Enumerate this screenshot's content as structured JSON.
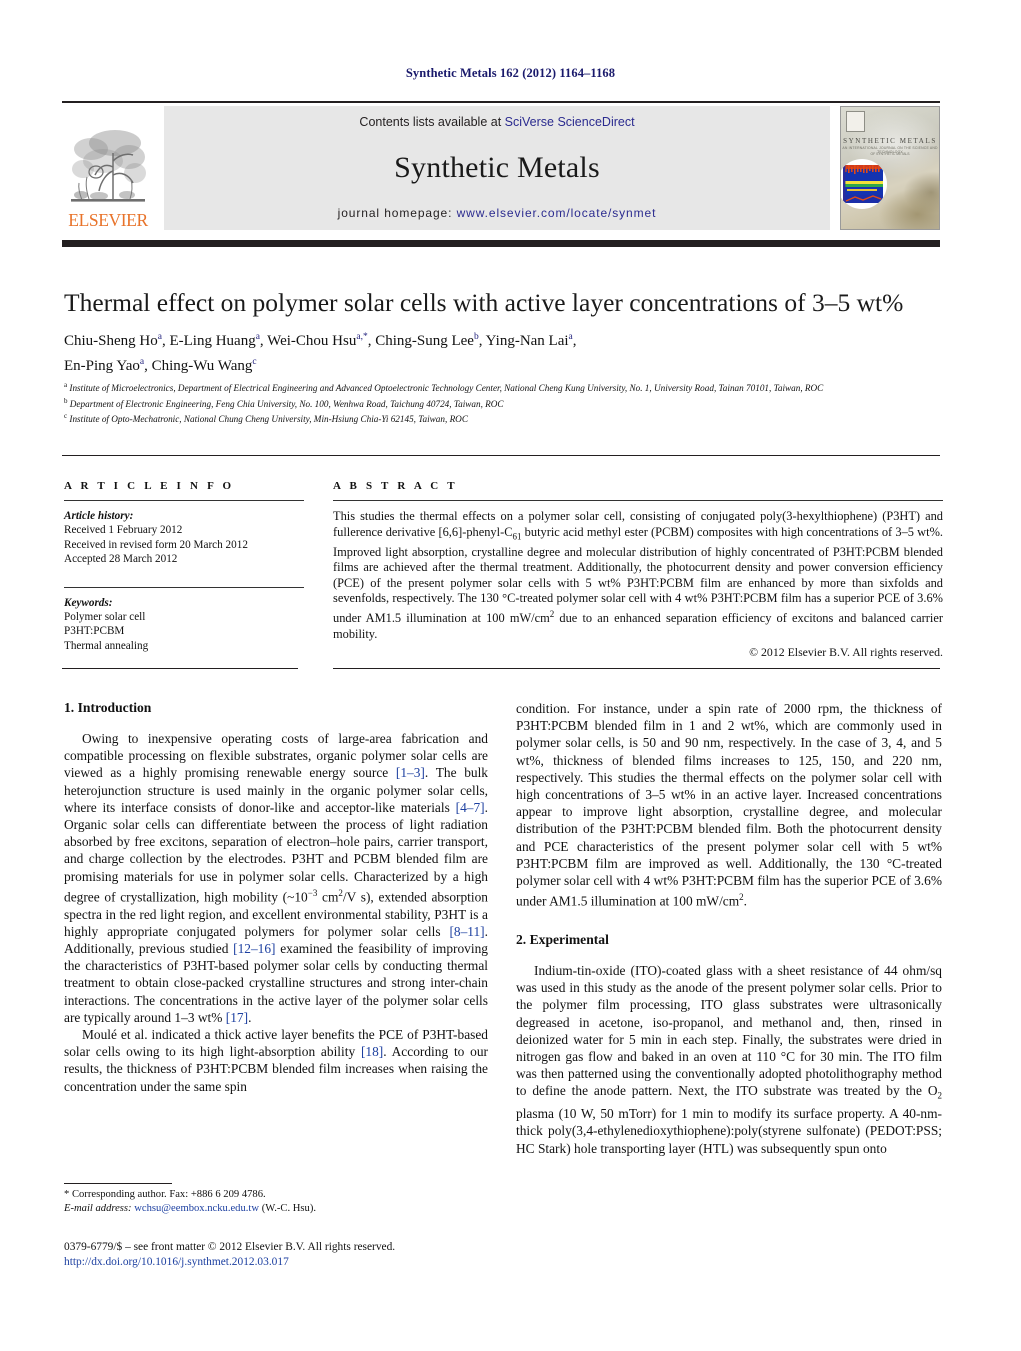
{
  "running_head": "Synthetic Metals 162 (2012) 1164–1168",
  "masthead": {
    "contents_prefix": "Contents lists available at ",
    "sciencedirect_link": "SciVerse ScienceDirect",
    "journal_name": "Synthetic Metals",
    "homepage_prefix": "journal homepage: ",
    "homepage_url": "www.elsevier.com/locate/synmet",
    "publisher_wordmark": "ELSEVIER",
    "cover": {
      "title": "SYNTHETIC METALS",
      "subtitle": "AN INTERNATIONAL JOURNAL ON THE SCIENCE AND TECHNOLOGY",
      "subtitle2": "OF SYNTHETIC METALS"
    },
    "accent_orange": "#e8732a",
    "link_blue": "#2b2b8f",
    "band_gray": "#e7e7e7"
  },
  "article": {
    "title": "Thermal effect on polymer solar cells with active layer concentrations of 3–5 wt%",
    "authors_line1": "Chiu-Sheng Ho<sup>a</sup>, E-Ling Huang<sup>a</sup>, Wei-Chou Hsu<sup>a,<span class=\"star\">*</span></sup>, Ching-Sung Lee<sup>b</sup>, Ying-Nan Lai<sup>a</sup>,",
    "authors_line2": "En-Ping Yao<sup>a</sup>, Ching-Wu Wang<sup>c</sup>",
    "affiliations": [
      "<sup>a</sup> Institute of Microelectronics, Department of Electrical Engineering and Advanced Optoelectronic Technology Center, National Cheng Kung University, No. 1, University Road, Tainan 70101, Taiwan, ROC",
      "<sup>b</sup> Department of Electronic Engineering, Feng Chia University, No. 100, Wenhwa Road, Taichung 40724, Taiwan, ROC",
      "<sup>c</sup> Institute of Opto-Mechatronic, National Chung Cheng University, Min-Hsiung Chia-Yi 62145, Taiwan, ROC"
    ]
  },
  "article_info": {
    "heading": "A R T I C L E   I N F O",
    "history_label": "Article history:",
    "history": [
      "Received 1 February 2012",
      "Received in revised form 20 March 2012",
      "Accepted 28 March 2012"
    ],
    "keywords_label": "Keywords:",
    "keywords": [
      "Polymer solar cell",
      "P3HT:PCBM",
      "Thermal annealing"
    ]
  },
  "abstract": {
    "heading": "A B S T R A C T",
    "text": "This studies the thermal effects on a polymer solar cell, consisting of conjugated poly(3-hexylthiophene) (P3HT) and fullerence derivative [6,6]-phenyl-C<sub class=\"s\">61</sub> butyric acid methyl ester (PCBM) composites with high concentrations of 3–5 wt%. Improved light absorption, crystalline degree and molecular distribution of highly concentrated of P3HT:PCBM blended films are achieved after the thermal treatment. Additionally, the photocurrent density and power conversion efficiency (PCE) of the present polymer solar cells with 5 wt% P3HT:PCBM film are enhanced by more than sixfolds and sevenfolds, respectively. The 130 °C-treated polymer solar cell with 4 wt% P3HT:PCBM film has a superior PCE of 3.6% under AM1.5 illumination at 100 mW/cm<sup class=\"s\">2</sup> due to an enhanced separation efficiency of excitons and balanced carrier mobility.",
    "copyright": "© 2012 Elsevier B.V. All rights reserved."
  },
  "body": {
    "section1_heading": "1.  Introduction",
    "section2_heading": "2.  Experimental",
    "left_paragraphs": [
      "Owing to inexpensive operating costs of large-area fabrication and compatible processing on flexible substrates, organic polymer solar cells are viewed as a highly promising renewable energy source <span class=\"ref\">[1–3]</span>. The bulk heterojunction structure is used mainly in the organic polymer solar cells, where its interface consists of donor-like and acceptor-like materials <span class=\"ref\">[4–7]</span>. Organic solar cells can differentiate between the process of light radiation absorbed by free excitons, separation of electron–hole pairs, carrier transport, and charge collection by the electrodes. P3HT and PCBM blended film are promising materials for use in polymer solar cells. Characterized by a high degree of crystallization, high mobility (~10<sup class=\"s\">−3</sup> cm<sup class=\"s\">2</sup>/V s), extended absorption spectra in the red light region, and excellent environmental stability, P3HT is a highly appropriate conjugated polymers for polymer solar cells <span class=\"ref\">[8–11]</span>. Additionally, previous studied <span class=\"ref\">[12–16]</span> examined the feasibility of improving the characteristics of P3HT-based polymer solar cells by conducting thermal treatment to obtain close-packed crystalline structures and strong inter-chain interactions. The concentrations in the active layer of the polymer solar cells are typically around 1–3 wt% <span class=\"ref\">[17]</span>.",
      "Moulé et al. indicated a thick active layer benefits the PCE of P3HT-based solar cells owing to its high light-absorption ability <span class=\"ref\">[18]</span>. According to our results, the thickness of P3HT:PCBM blended film increases when raising the concentration under the same spin"
    ],
    "right_paragraphs": [
      "condition. For instance, under a spin rate of 2000 rpm, the thickness of P3HT:PCBM blended film in 1 and 2 wt%, which are commonly used in polymer solar cells, is 50 and 90 nm, respectively. In the case of 3, 4, and 5 wt%, thickness of blended films increases to 125, 150, and 220 nm, respectively. This studies the thermal effects on the polymer solar cell with high concentrations of 3–5 wt% in an active layer. Increased concentrations appear to improve light absorption, crystalline degree, and molecular distribution of the P3HT:PCBM blended film. Both the photocurrent density and PCE characteristics of the present polymer solar cell with 5 wt% P3HT:PCBM film are improved as well. Additionally, the 130 °C-treated polymer solar cell with 4 wt% P3HT:PCBM film has the superior PCE of 3.6% under AM1.5 illumination at 100 mW/cm<sup class=\"s\">2</sup>.",
      "Indium-tin-oxide (ITO)-coated glass with a sheet resistance of 44 ohm/sq was used in this study as the anode of the present polymer solar cells. Prior to the polymer film processing, ITO glass substrates were ultrasonically degreased in acetone, iso-propanol, and methanol and, then, rinsed in deionized water for 5 min in each step. Finally, the substrates were dried in nitrogen gas flow and baked in an oven at 110 °C for 30 min. The ITO film was then patterned using the conventionally adopted photolithography method to define the anode pattern. Next, the ITO substrate was treated by the O<sub class=\"s\">2</sub> plasma (10 W, 50 mTorr) for 1 min to modify its surface property. A 40-nm-thick poly(3,4-ethylenedioxythiophene):poly(styrene sulfonate) (PEDOT:PSS; HC Stark) hole transporting layer (HTL) was subsequently spun onto"
    ]
  },
  "footnote": {
    "corresponding": "* Corresponding author. Fax: +886 6 209 4786.",
    "email_label": "E-mail address:",
    "email": "wchsu@eembox.ncku.edu.tw",
    "email_suffix": "(W.-C. Hsu).",
    "issn_line": "0379-6779/$ – see front matter © 2012 Elsevier B.V. All rights reserved.",
    "doi": "http://dx.doi.org/10.1016/j.synthmet.2012.03.017"
  }
}
